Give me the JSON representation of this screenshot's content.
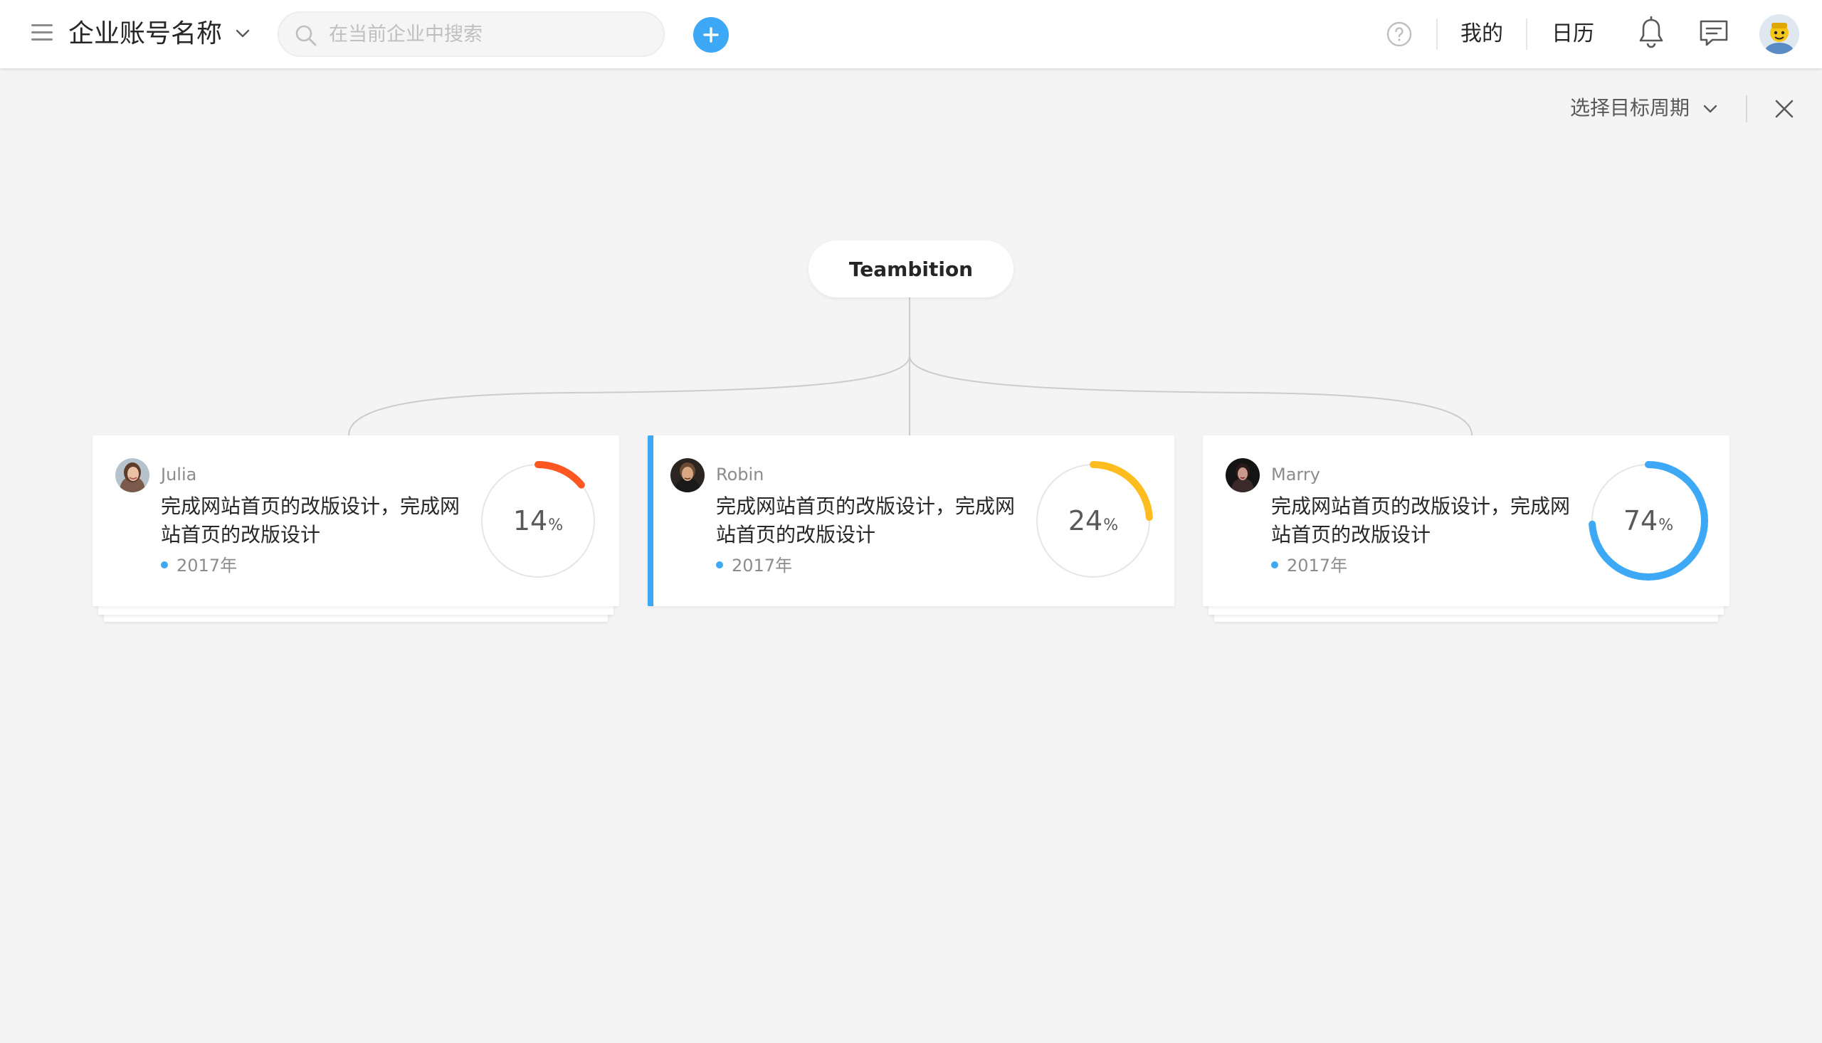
{
  "header": {
    "org_name": "企业账号名称",
    "search_placeholder": "在当前企业中搜索",
    "nav": {
      "mine": "我的",
      "calendar": "日历"
    },
    "accent_color": "#3da8f5",
    "icons": [
      "menu-icon",
      "chevron-down-icon",
      "search-icon",
      "plus-icon",
      "help-icon",
      "bell-icon",
      "chat-icon",
      "avatar"
    ]
  },
  "toolbar": {
    "period_label": "选择目标周期",
    "icons": [
      "chevron-down-icon",
      "close-icon"
    ]
  },
  "tree": {
    "root_label": "Teambition"
  },
  "cards": [
    {
      "owner": "Julia",
      "title": "完成网站首页的改版设计，完成网站首页的改版设计",
      "period": "2017年",
      "progress": 14,
      "progress_label": "14",
      "color": "#ff5722",
      "active": false
    },
    {
      "owner": "Robin",
      "title": "完成网站首页的改版设计，完成网站首页的改版设计",
      "period": "2017年",
      "progress": 24,
      "progress_label": "24",
      "color": "#ffbc1f",
      "active": true
    },
    {
      "owner": "Marry",
      "title": "完成网站首页的改版设计，完成网站首页的改版设计",
      "period": "2017年",
      "progress": 74,
      "progress_label": "74",
      "color": "#3da8f5",
      "active": false
    }
  ],
  "percent_sign": "%"
}
